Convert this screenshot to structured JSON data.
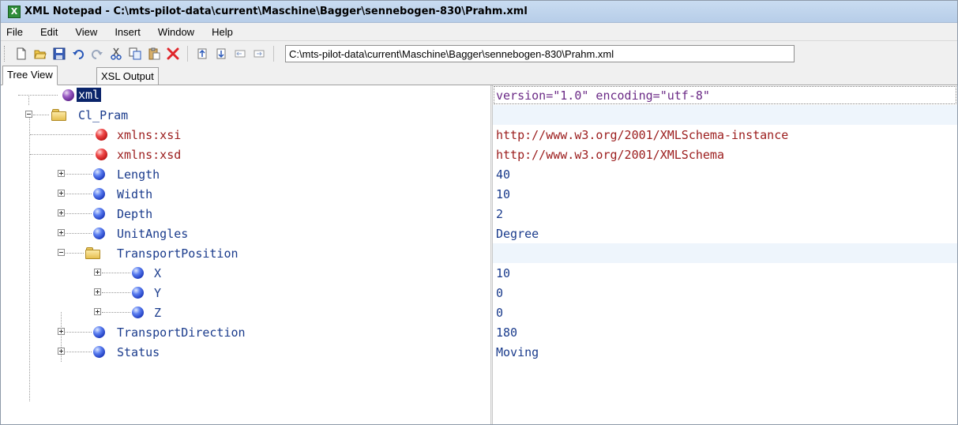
{
  "window": {
    "title": "XML Notepad - C:\\mts-pilot-data\\current\\Maschine\\Bagger\\sennebogen-830\\Prahm.xml",
    "app_icon_glyph": "X"
  },
  "menu": [
    "File",
    "Edit",
    "View",
    "Insert",
    "Window",
    "Help"
  ],
  "toolbar": {
    "buttons": [
      "new-icon",
      "open-icon",
      "save-icon",
      "undo-icon",
      "redo-icon",
      "cut-icon",
      "copy-icon",
      "paste-icon",
      "delete-icon",
      "nudge-up-icon",
      "nudge-down-icon",
      "outdent-icon",
      "indent-icon"
    ],
    "path": "C:\\mts-pilot-data\\current\\Maschine\\Bagger\\sennebogen-830\\Prahm.xml"
  },
  "tabs": [
    {
      "label": "Tree View",
      "active": true
    },
    {
      "label": "XSL Output",
      "active": false
    }
  ],
  "tree": [
    {
      "name": "xml",
      "kind": "pi",
      "value": "version=\"1.0\" encoding=\"utf-8\""
    },
    {
      "name": "Cl_Pram",
      "kind": "folder",
      "value": ""
    },
    {
      "name": "xmlns:xsi",
      "kind": "attr",
      "value": "http://www.w3.org/2001/XMLSchema-instance"
    },
    {
      "name": "xmlns:xsd",
      "kind": "attr",
      "value": "http://www.w3.org/2001/XMLSchema"
    },
    {
      "name": "Length",
      "kind": "elem",
      "value": "40"
    },
    {
      "name": "Width",
      "kind": "elem",
      "value": "10"
    },
    {
      "name": "Depth",
      "kind": "elem",
      "value": "2"
    },
    {
      "name": "UnitAngles",
      "kind": "elem",
      "value": "Degree"
    },
    {
      "name": "TransportPosition",
      "kind": "folder",
      "value": ""
    },
    {
      "name": "X",
      "kind": "elem",
      "value": "10"
    },
    {
      "name": "Y",
      "kind": "elem",
      "value": "0"
    },
    {
      "name": "Z",
      "kind": "elem",
      "value": "0"
    },
    {
      "name": "TransportDirection",
      "kind": "elem",
      "value": "180"
    },
    {
      "name": "Status",
      "kind": "elem",
      "value": "Moving"
    }
  ],
  "colors": {
    "element_text": "#1a3b8c",
    "attribute_text": "#9b1c1c",
    "selection": "#0a246a",
    "band": "#eef5fc"
  }
}
